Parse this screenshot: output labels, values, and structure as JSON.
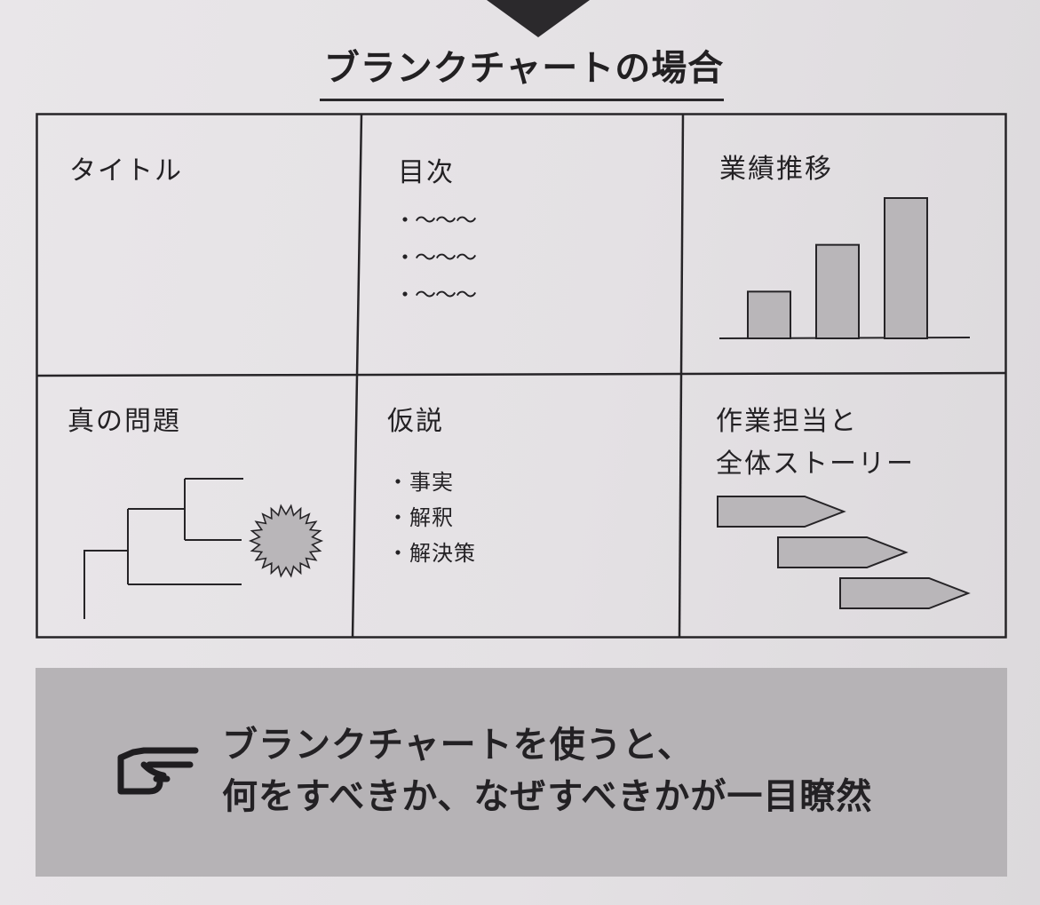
{
  "heading": {
    "title": "ブランクチャートの場合"
  },
  "cells": {
    "title_slide": {
      "label": "タイトル"
    },
    "toc": {
      "label": "目次",
      "items": [
        "・〜〜〜",
        "・〜〜〜",
        "・〜〜〜"
      ]
    },
    "performance": {
      "label": "業績推移",
      "bar_levels": [
        1,
        2,
        3
      ]
    },
    "true_problem": {
      "label": "真の問題"
    },
    "hypothesis": {
      "label": "仮説",
      "items": [
        "・事実",
        "・解釈",
        "・解決策"
      ]
    },
    "assignment": {
      "label_line1": "作業担当と",
      "label_line2": "全体ストーリー"
    }
  },
  "callout": {
    "icon": "pointing-hand-icon",
    "line1": "ブランクチャートを使うと、",
    "line2": "何をすべきか、なぜすべきかが一目瞭然"
  },
  "colors": {
    "shape_fill": "#b9b6b9",
    "callout_bg": "#b6b3b6",
    "ink": "#232124"
  }
}
